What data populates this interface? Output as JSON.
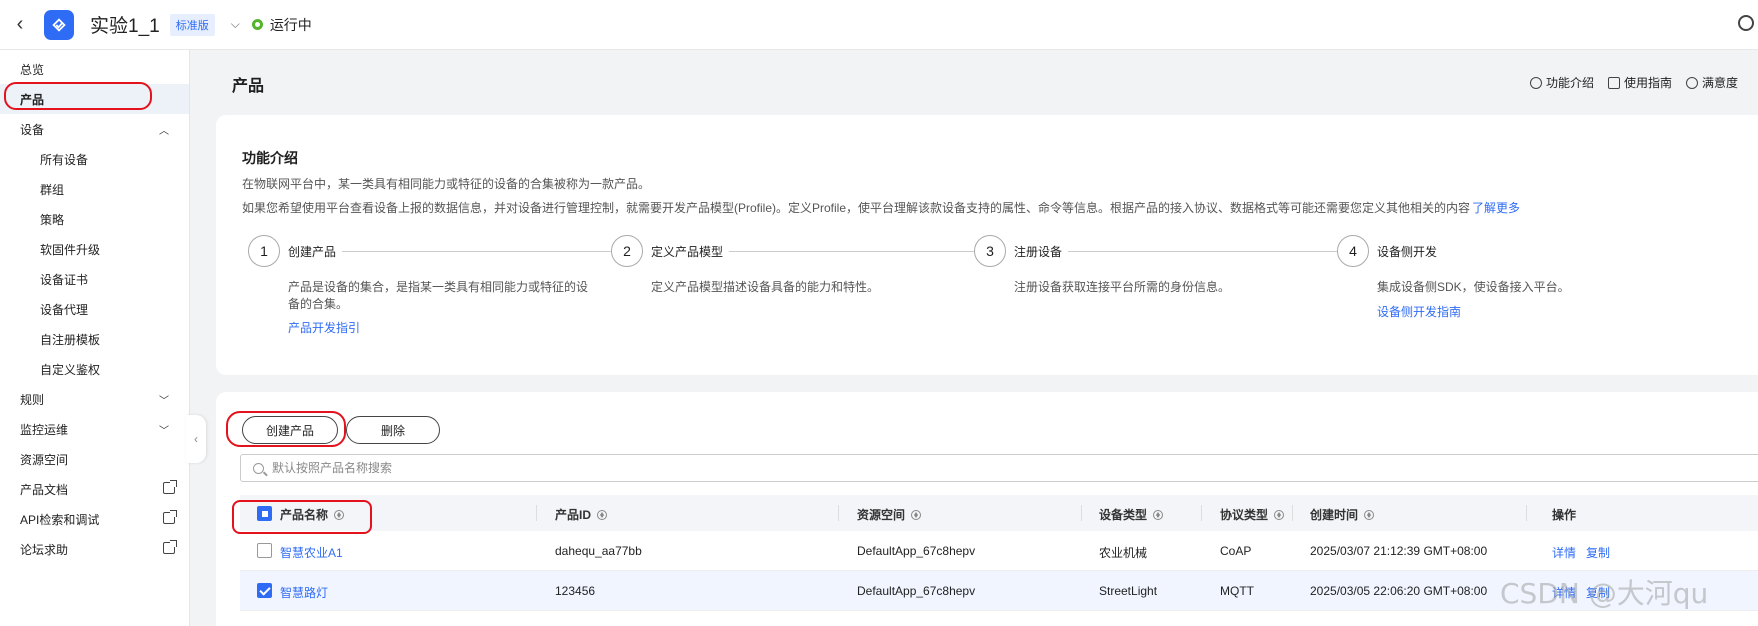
{
  "topbar": {
    "back_label": "‹",
    "app_title": "实验1_1",
    "edition_badge": "标准版",
    "status_text": "运行中",
    "status_color": "#52b52b"
  },
  "sidebar": {
    "items": [
      {
        "label": "总览"
      },
      {
        "label": "产品"
      },
      {
        "label": "设备"
      },
      {
        "label": "所有设备"
      },
      {
        "label": "群组"
      },
      {
        "label": "策略"
      },
      {
        "label": "软固件升级"
      },
      {
        "label": "设备证书"
      },
      {
        "label": "设备代理"
      },
      {
        "label": "自注册模板"
      },
      {
        "label": "自定义鉴权"
      },
      {
        "label": "规则"
      },
      {
        "label": "监控运维"
      },
      {
        "label": "资源空间"
      },
      {
        "label": "产品文档"
      },
      {
        "label": "API检索和调试"
      },
      {
        "label": "论坛求助"
      }
    ]
  },
  "page": {
    "title": "产品",
    "header_links": [
      "功能介绍",
      "使用指南",
      "满意度"
    ]
  },
  "intro": {
    "title": "功能介绍",
    "desc1": "在物联网平台中，某一类具有相同能力或特征的设备的合集被称为一款产品。",
    "desc2": "如果您希望使用平台查看设备上报的数据信息，并对设备进行管理控制，就需要开发产品模型(Profile)。定义Profile，使平台理解该款设备支持的属性、命令等信息。根据产品的接入协议、数据格式等可能还需要您定义其他相关的内容",
    "more_link": "了解更多",
    "steps": [
      {
        "num": "1",
        "title": "创建产品",
        "desc": "产品是设备的集合，是指某一类具有相同能力或特征的设备的合集。",
        "link": "产品开发指引"
      },
      {
        "num": "2",
        "title": "定义产品模型",
        "desc": "定义产品模型描述设备具备的能力和特性。",
        "link": ""
      },
      {
        "num": "3",
        "title": "注册设备",
        "desc": "注册设备获取连接平台所需的身份信息。",
        "link": ""
      },
      {
        "num": "4",
        "title": "设备侧开发",
        "desc": "集成设备侧SDK，使设备接入平台。",
        "link": "设备侧开发指南"
      }
    ]
  },
  "toolbar": {
    "create_label": "创建产品",
    "delete_label": "删除"
  },
  "search": {
    "placeholder": "默认按照产品名称搜索"
  },
  "table": {
    "headers": [
      "产品名称",
      "产品ID",
      "资源空间",
      "设备类型",
      "协议类型",
      "创建时间",
      "操作"
    ],
    "rows": [
      {
        "name": "智慧农业A1",
        "id": "dahequ_aa77bb",
        "space": "DefaultApp_67c8hepv",
        "device_type": "农业机械",
        "protocol": "CoAP",
        "created": "2025/03/07 21:12:39 GMT+08:00",
        "action1": "详情",
        "action2": "复制",
        "checked": false
      },
      {
        "name": "智慧路灯",
        "id": "123456",
        "space": "DefaultApp_67c8hepv",
        "device_type": "StreetLight",
        "protocol": "MQTT",
        "created": "2025/03/05 22:06:20 GMT+08:00",
        "action1": "详情",
        "action2": "复制",
        "checked": true
      }
    ]
  },
  "watermark": "CSDN @大河qu",
  "colors": {
    "accent": "#2f6cf6",
    "highlight": "#e3121c"
  }
}
